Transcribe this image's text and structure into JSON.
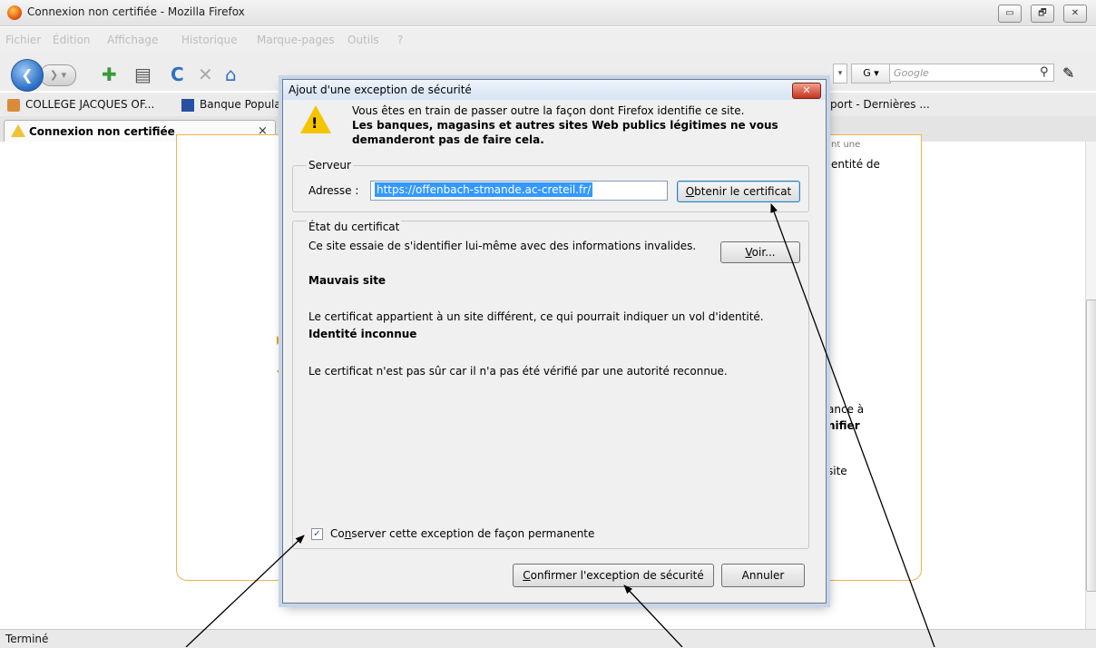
{
  "window": {
    "title": "Connexion non certifiée - Mozilla Firefox",
    "controls": [
      "▭",
      "🗗",
      "✕"
    ]
  },
  "menu": {
    "items": [
      "Fichier",
      "Édition",
      "Affichage",
      "Historique",
      "Marque-pages",
      "Outils",
      "?"
    ]
  },
  "toolbar": {
    "back": "❮",
    "forward": "❯ ▾",
    "search_engine": "G ▾",
    "search_placeholder": "Google",
    "search_button": "⚲"
  },
  "bookmarks": {
    "items": [
      "COLLEGE JACQUES OF...",
      "Banque Popula",
      "port - Dernières ..."
    ]
  },
  "tab": {
    "label": "Connexion non certifiée",
    "close": "×"
  },
  "page": {
    "fragments": [
      "entité de",
      "ance à",
      "nifier",
      "site",
      "nt une"
    ]
  },
  "dialog": {
    "title": "Ajout d'une exception de sécurité",
    "close": "✕",
    "warning_line1": "Vous êtes en train de passer outre la façon dont Firefox identifie ce site.",
    "warning_line2": "Les banques, magasins et autres sites Web publics légitimes ne vous demanderont pas de faire cela.",
    "server": {
      "legend": "Serveur",
      "address_label": "Adresse :",
      "address_value": "https://offenbach-stmande.ac-creteil.fr/",
      "get_cert_button": "btenir le certificat",
      "get_cert_mnemonic": "O"
    },
    "cert_status": {
      "legend": "État du certificat",
      "description": "Ce site essaie de s'identifier lui-même avec des informations invalides.",
      "view_button": "oir...",
      "view_mnemonic": "V",
      "issue1_title": "Mauvais site",
      "issue1_text": "Le certificat appartient à un site différent, ce qui pourrait indiquer un vol d'identité.",
      "issue2_title": "Identité inconnue",
      "issue2_text": "Le certificat n'est pas sûr car il n'a pas été vérifié par une autorité reconnue."
    },
    "permanent": {
      "checked": true,
      "mark": "✓",
      "label_pre": "Co",
      "label_mnemonic": "n",
      "label_post": "server cette exception de façon permanente"
    },
    "confirm_button": {
      "mnemonic": "C",
      "label": "onfirmer l'exception de sécurité"
    },
    "cancel_button": "Annuler"
  },
  "statusbar": {
    "text": "Terminé"
  }
}
